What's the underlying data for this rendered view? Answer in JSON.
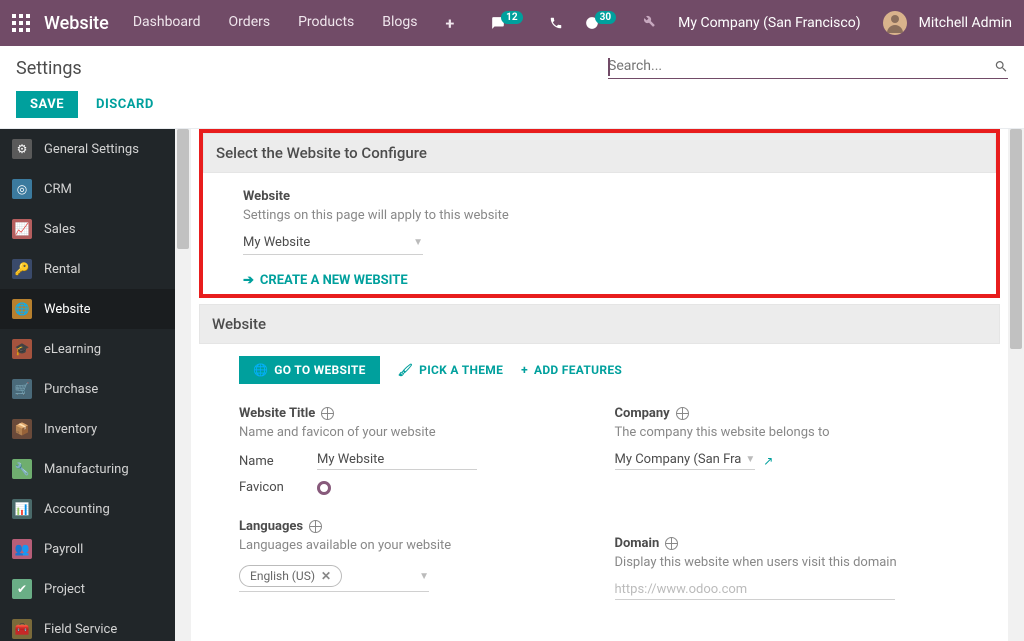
{
  "nav": {
    "brand": "Website",
    "links": [
      "Dashboard",
      "Orders",
      "Products",
      "Blogs"
    ],
    "msg_badge": "12",
    "activity_badge": "30",
    "company": "My Company (San Francisco)",
    "user": "Mitchell Admin"
  },
  "title": "Settings",
  "search_placeholder": "Search...",
  "actions": {
    "save": "SAVE",
    "discard": "DISCARD"
  },
  "sidebar": [
    {
      "label": "General Settings",
      "icon": "ic-gen",
      "glyph": "⚙"
    },
    {
      "label": "CRM",
      "icon": "ic-crm",
      "glyph": "◎"
    },
    {
      "label": "Sales",
      "icon": "ic-sales",
      "glyph": "📈"
    },
    {
      "label": "Rental",
      "icon": "ic-rental",
      "glyph": "🔑"
    },
    {
      "label": "Website",
      "icon": "ic-web",
      "glyph": "🌐",
      "active": true
    },
    {
      "label": "eLearning",
      "icon": "ic-elearn",
      "glyph": "🎓"
    },
    {
      "label": "Purchase",
      "icon": "ic-purch",
      "glyph": "🛒"
    },
    {
      "label": "Inventory",
      "icon": "ic-inv",
      "glyph": "📦"
    },
    {
      "label": "Manufacturing",
      "icon": "ic-manu",
      "glyph": "🔧"
    },
    {
      "label": "Accounting",
      "icon": "ic-acct",
      "glyph": "📊"
    },
    {
      "label": "Payroll",
      "icon": "ic-pay",
      "glyph": "👥"
    },
    {
      "label": "Project",
      "icon": "ic-proj",
      "glyph": "✔"
    },
    {
      "label": "Field Service",
      "icon": "ic-field",
      "glyph": "🧰"
    }
  ],
  "select_section": {
    "header": "Select the Website to Configure",
    "field_title": "Website",
    "field_desc": "Settings on this page will apply to this website",
    "selected": "My Website",
    "create": "CREATE A NEW WEBSITE"
  },
  "website_section": {
    "header": "Website",
    "go": "GO TO WEBSITE",
    "pick": "PICK A THEME",
    "add": "ADD FEATURES",
    "title_label": "Website Title",
    "title_desc": "Name and favicon of your website",
    "name_label": "Name",
    "name_value": "My Website",
    "favicon_label": "Favicon",
    "company_label": "Company",
    "company_desc": "The company this website belongs to",
    "company_value": "My Company (San Fra",
    "languages_label": "Languages",
    "languages_desc": "Languages available on your website",
    "lang_tag": "English (US)",
    "domain_label": "Domain",
    "domain_desc": "Display this website when users visit this domain",
    "domain_placeholder": "https://www.odoo.com"
  }
}
